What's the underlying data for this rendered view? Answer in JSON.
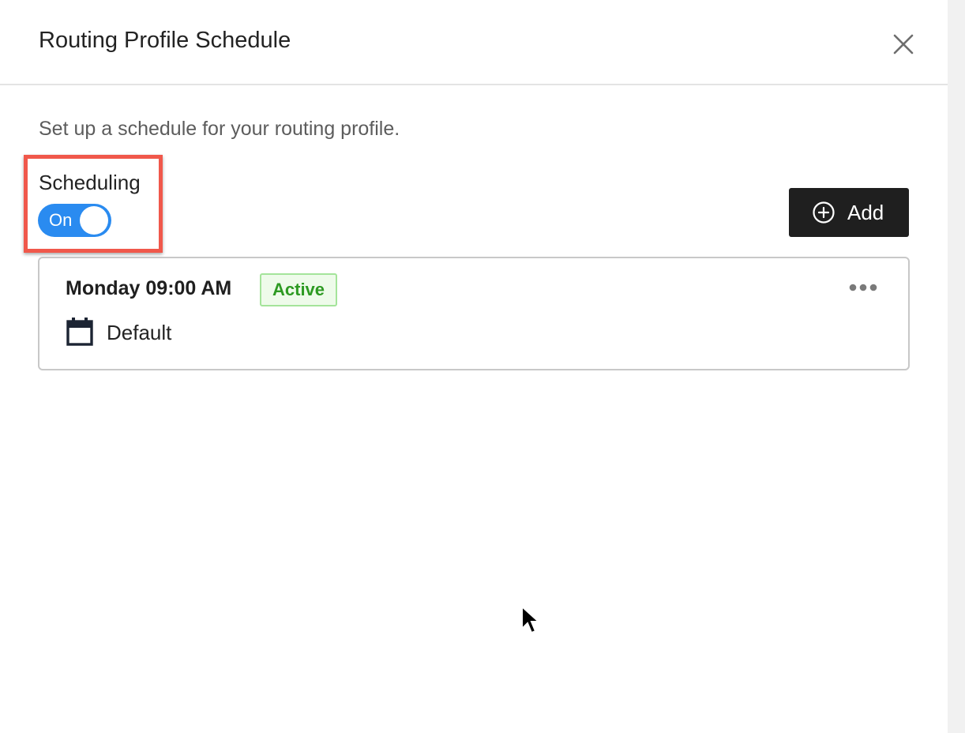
{
  "panel": {
    "title": "Routing Profile Schedule",
    "subtitle": "Set up a schedule for your routing profile."
  },
  "scheduling": {
    "label": "Scheduling",
    "toggle_state": "On",
    "enabled": true
  },
  "toolbar": {
    "add_label": "Add"
  },
  "schedules": [
    {
      "title": "Monday 09:00 AM",
      "status": "Active",
      "profile": "Default"
    }
  ],
  "icons": {
    "close": "close-icon",
    "add": "plus-circle-icon",
    "more": "more-horizontal-icon",
    "calendar": "calendar-icon",
    "cursor": "mouse-pointer-icon"
  },
  "colors": {
    "toggle_on": "#2a8bf0",
    "add_button_bg": "#1f1f1f",
    "status_active_text": "#2d9a22",
    "status_active_border": "#a4e49a",
    "status_active_bg": "#eefbea",
    "highlight": "#f0584b"
  }
}
